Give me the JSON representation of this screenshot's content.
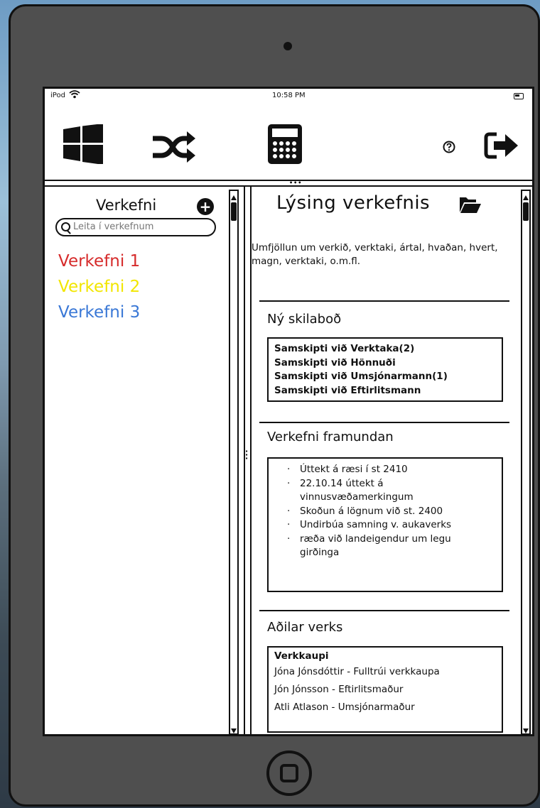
{
  "status_bar": {
    "carrier": "iPod",
    "time": "10:58 PM"
  },
  "toolbar": {
    "icons": [
      "windows-icon",
      "shuffle-icon",
      "calculator-icon",
      "help-icon",
      "logout-icon"
    ]
  },
  "sidebar": {
    "title": "Verkefni",
    "search_placeholder": "Leita í verkefnum",
    "projects": [
      {
        "label": "Verkefni 1",
        "color": "#d62b2b"
      },
      {
        "label": "Verkefni 2",
        "color": "#f2e600"
      },
      {
        "label": "Verkefni 3",
        "color": "#3a78d6"
      }
    ]
  },
  "main": {
    "title": "Lýsing verkefnis",
    "description": "Umfjöllun um verkið, verktaki, ártal, hvaðan, hvert, magn, verktaki, o.m.fl.",
    "messages": {
      "title": "Ný skilaboð",
      "items": [
        "Samskipti við Verktaka(2)",
        "Samskipti við Hönnuði",
        "Samskipti við Umsjónarmann(1)",
        "Samskipti við Eftirlitsmann"
      ]
    },
    "upcoming": {
      "title": "Verkefni framundan",
      "items": [
        "Úttekt á ræsi í st 2410",
        "22.10.14 úttekt á vinnusvæðamerkingum",
        "Skoðun á lögnum við st. 2400",
        "Undirbúa samning v. aukaverks",
        "ræða við landeigendur um legu girðinga"
      ]
    },
    "parties": {
      "title": "Aðilar verks",
      "header": "Verkkaupi",
      "items": [
        "Jóna Jónsdóttir - Fulltrúi verkkaupa",
        "Jón Jónsson - Eftirlitsmaður",
        "Atli Atlason - Umsjónarmaður"
      ]
    }
  }
}
